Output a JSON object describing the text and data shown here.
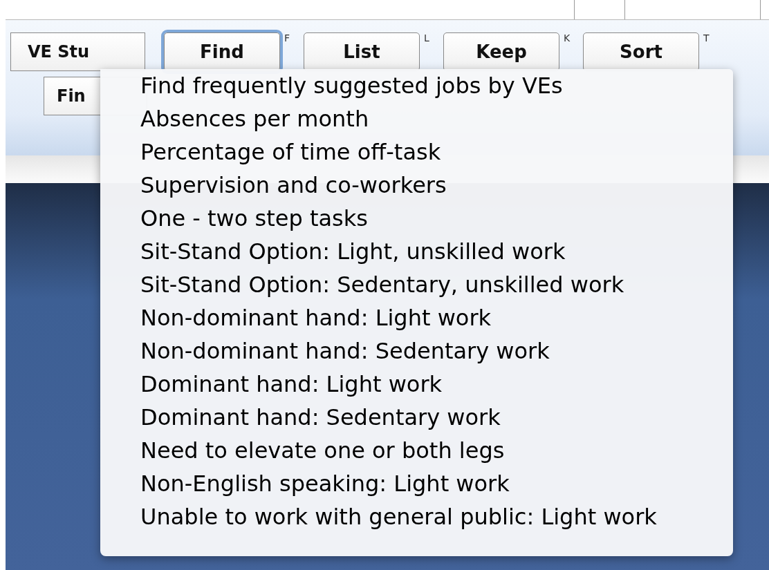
{
  "toolbar": {
    "buttons": [
      {
        "label": "VE Stu",
        "focused": false
      },
      {
        "label": "Find",
        "shortcut": "F",
        "focused": true
      },
      {
        "label": "List",
        "shortcut": "L",
        "focused": false
      },
      {
        "label": "Keep",
        "shortcut": "K",
        "focused": false
      },
      {
        "label": "Sort",
        "shortcut": "T",
        "focused": false
      }
    ],
    "second_row_button": "Fin"
  },
  "menu": {
    "items": [
      "Find frequently suggested jobs by VEs",
      "Absences per month",
      "Percentage of time off-task",
      "Supervision and co-workers",
      "One - two step tasks",
      "Sit-Stand Option: Light, unskilled work",
      "Sit-Stand Option: Sedentary, unskilled work",
      "Non-dominant hand: Light work",
      "Non-dominant hand: Sedentary work",
      "Dominant hand: Light work",
      "Dominant hand: Sedentary work",
      "Need to elevate one or both legs",
      "Non-English speaking: Light work",
      "Unable to work with general public: Light work"
    ]
  }
}
